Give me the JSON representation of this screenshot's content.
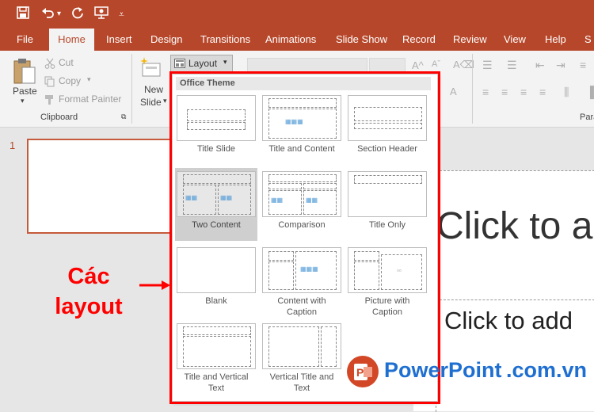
{
  "quick_access": {
    "save": "save-icon",
    "undo": "undo-icon",
    "redo": "redo-icon",
    "present": "present-icon",
    "customize": "chevron-down-icon"
  },
  "tabs": [
    "File",
    "Home",
    "Insert",
    "Design",
    "Transitions",
    "Animations",
    "Slide Show",
    "Record",
    "Review",
    "View",
    "Help",
    "S"
  ],
  "active_tab": "Home",
  "ribbon": {
    "paste_label": "Paste",
    "cut_label": "Cut",
    "copy_label": "Copy",
    "format_painter_label": "Format Painter",
    "clipboard_group": "Clipboard",
    "new_slide_label_1": "New",
    "new_slide_label_2": "Slide",
    "layout_label": "Layout",
    "paragraph_group": "Para"
  },
  "slide_number": "1",
  "canvas_text": {
    "title": "Click to a",
    "subtitle": "Click to add"
  },
  "dropdown": {
    "header": "Office Theme",
    "layouts": [
      {
        "line1": "Title Slide",
        "line2": ""
      },
      {
        "line1": "Title and Content",
        "line2": ""
      },
      {
        "line1": "Section Header",
        "line2": ""
      },
      {
        "line1": "Two Content",
        "line2": ""
      },
      {
        "line1": "Comparison",
        "line2": ""
      },
      {
        "line1": "Title Only",
        "line2": ""
      },
      {
        "line1": "Blank",
        "line2": ""
      },
      {
        "line1": "Content with",
        "line2": "Caption"
      },
      {
        "line1": "Picture with",
        "line2": "Caption"
      },
      {
        "line1": "Title and Vertical",
        "line2": "Text"
      },
      {
        "line1": "Vertical Title and",
        "line2": "Text"
      }
    ],
    "selected_index": 3
  },
  "annotation": {
    "line1": "Các",
    "line2": "layout"
  },
  "watermark": {
    "brand": "PowerPoint",
    "suffix": ".com.vn"
  },
  "colors": {
    "accent": "#b7472a",
    "annotation_red": "#ff0000",
    "watermark_blue": "#1f6fd1"
  }
}
